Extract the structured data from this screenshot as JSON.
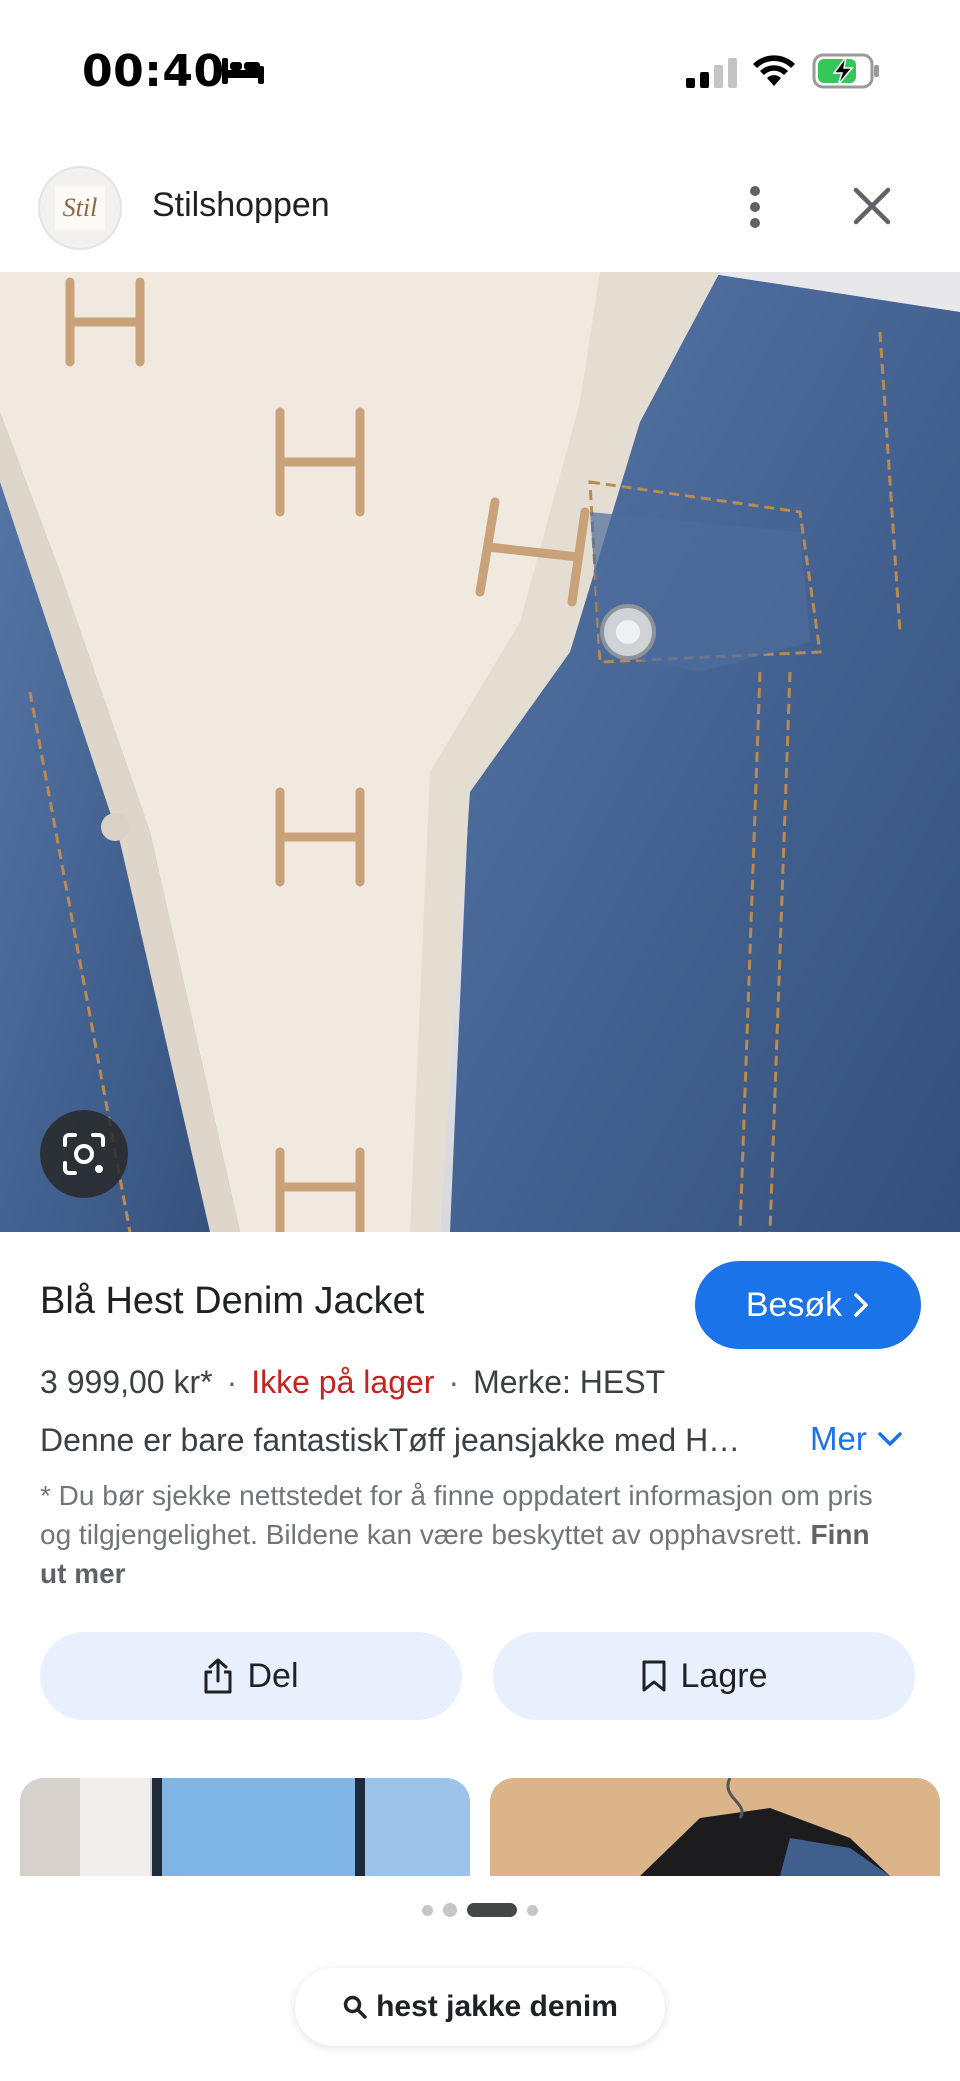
{
  "status_bar": {
    "time": "00:40",
    "icons": [
      "bed-icon",
      "signal-icon",
      "wifi-icon",
      "battery-charging-icon"
    ]
  },
  "source": {
    "favicon_text": "Stil",
    "name": "Stilshoppen",
    "icons": [
      "more-vert-icon",
      "close-icon"
    ]
  },
  "product": {
    "title": "Blå Hest Denim Jacket",
    "visit_label": "Besøk",
    "price": "3 999,00 kr*",
    "separator": "·",
    "stock": "Ikke på lager",
    "brand": "Merke: HEST",
    "description": "Denne er bare fantastiskTøff jeansjakke med H…",
    "more_label": "Mer",
    "disclaimer": "* Du bør sjekke nettstedet for å finne oppdatert informasjon om pris og tilgjengelighet. Bildene kan være beskyttet av opphavsrett.",
    "disclaimer_link": "Finn ut mer"
  },
  "actions": {
    "share_label": "Del",
    "save_label": "Lagre"
  },
  "search": {
    "query": "hest jakke denim"
  },
  "colors": {
    "accent": "#1a73e8",
    "out_of_stock": "#c5221f",
    "action_bg": "#e8f0fe",
    "denim": "#3e5f8f"
  }
}
